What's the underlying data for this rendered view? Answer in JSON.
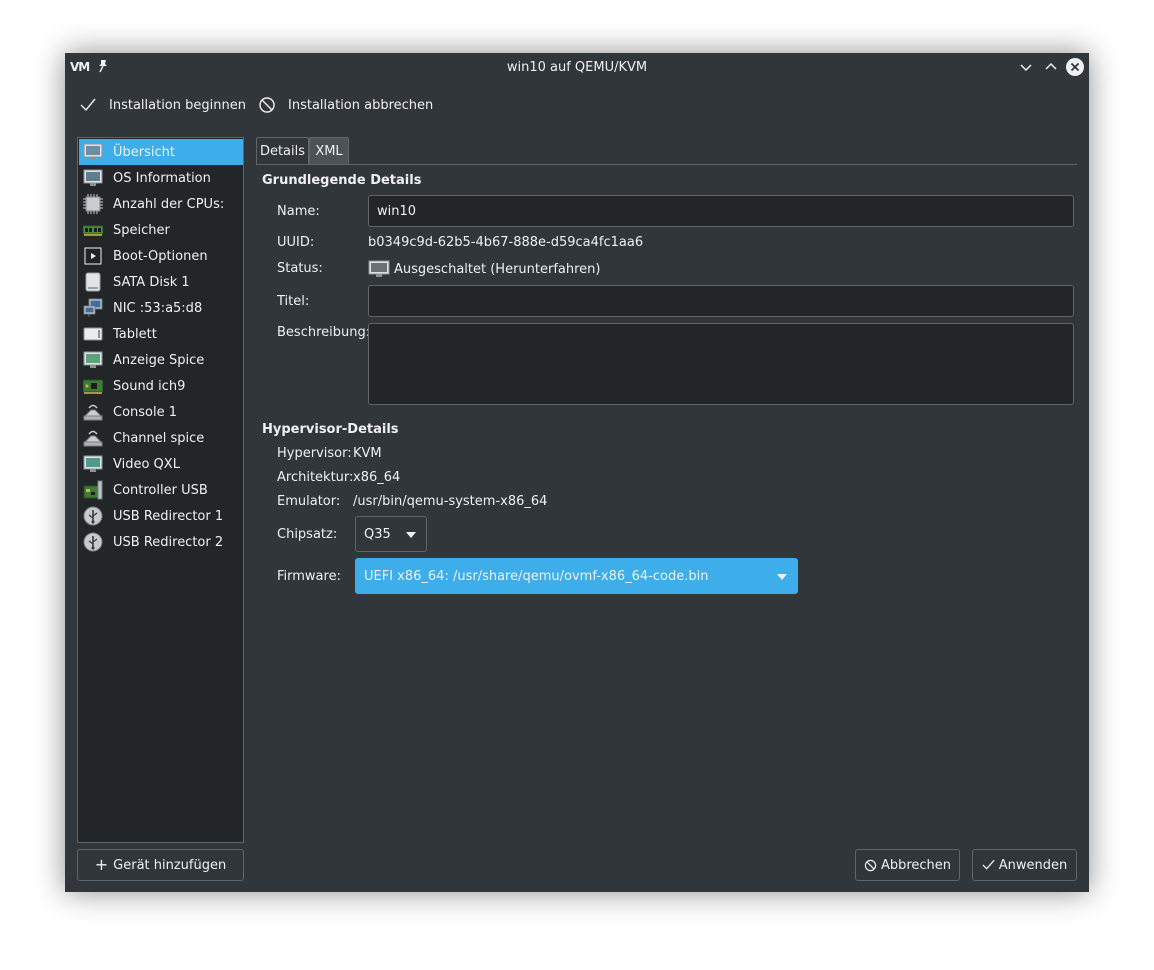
{
  "window": {
    "title": "win10 auf QEMU/KVM",
    "app_icon_text": "VM"
  },
  "toolbar": {
    "begin_install": "Installation beginnen",
    "abort_install": "Installation abbrechen"
  },
  "sidebar": {
    "items": [
      {
        "label": "Übersicht",
        "icon": "overview-monitor-icon"
      },
      {
        "label": "OS Information",
        "icon": "os-info-icon"
      },
      {
        "label": "Anzahl der CPUs:",
        "icon": "cpu-chip-icon"
      },
      {
        "label": "Speicher",
        "icon": "memory-ram-icon"
      },
      {
        "label": "Boot-Optionen",
        "icon": "boot-options-icon"
      },
      {
        "label": "SATA Disk 1",
        "icon": "disk-icon"
      },
      {
        "label": "NIC :53:a5:d8",
        "icon": "network-card-icon"
      },
      {
        "label": "Tablett",
        "icon": "tablet-icon"
      },
      {
        "label": "Anzeige Spice",
        "icon": "display-icon"
      },
      {
        "label": "Sound ich9",
        "icon": "sound-card-icon"
      },
      {
        "label": "Console 1",
        "icon": "console-icon"
      },
      {
        "label": "Channel spice",
        "icon": "channel-icon"
      },
      {
        "label": "Video QXL",
        "icon": "video-icon"
      },
      {
        "label": "Controller USB",
        "icon": "controller-icon"
      },
      {
        "label": "USB Redirector 1",
        "icon": "usb-icon"
      },
      {
        "label": "USB Redirector 2",
        "icon": "usb-icon"
      }
    ],
    "add_device": "Gerät hinzufügen"
  },
  "tabs": {
    "details": "Details",
    "xml": "XML"
  },
  "basic": {
    "title": "Grundlegende Details",
    "name_label": "Name:",
    "name_value": "win10",
    "uuid_label": "UUID:",
    "uuid_value": "b0349c9d-62b5-4b67-888e-d59ca4fc1aa6",
    "status_label": "Status:",
    "status_value": "Ausgeschaltet (Herunterfahren)",
    "title_label": "Titel:",
    "title_value": "",
    "description_label": "Beschreibung:",
    "description_value": ""
  },
  "hypervisor": {
    "title": "Hypervisor-Details",
    "hypervisor_label": "Hypervisor:",
    "hypervisor_value": "KVM",
    "arch_label": "Architektur:",
    "arch_value": "x86_64",
    "emulator_label": "Emulator:",
    "emulator_value": "/usr/bin/qemu-system-x86_64",
    "chipset_label": "Chipsatz:",
    "chipset_value": "Q35",
    "firmware_label": "Firmware:",
    "firmware_value": "UEFI x86_64: /usr/share/qemu/ovmf-x86_64-code.bin"
  },
  "buttons": {
    "cancel": "Abbrechen",
    "apply": "Anwenden"
  },
  "colors": {
    "window_bg": "#31363b",
    "field_bg": "#232629",
    "accent": "#3daee9",
    "border": "#616569",
    "text": "#eff0f1"
  }
}
